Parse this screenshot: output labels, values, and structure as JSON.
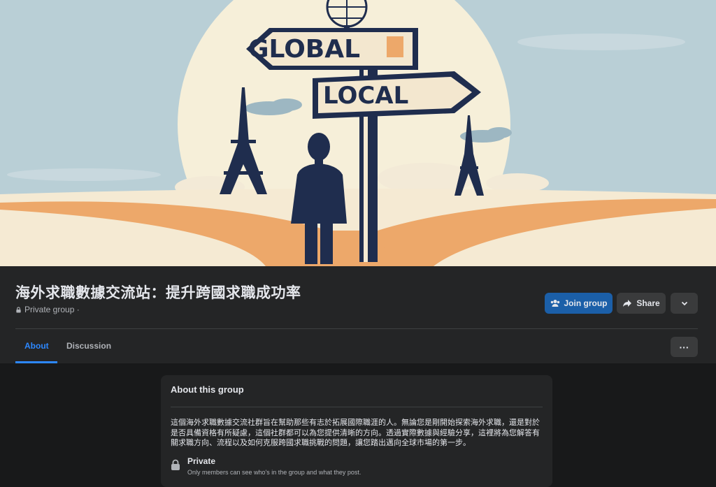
{
  "cover": {
    "sign_global": "GLOBAL",
    "sign_local": "LOCAL",
    "colors": {
      "sky": "#b9cfd6",
      "sun": "#f6efd9",
      "ground": "#f5ead3",
      "road": "#eda86a",
      "navy": "#1f2d4e"
    }
  },
  "group": {
    "title": "海外求職數據交流站：提升跨國求職成功率",
    "privacy": "Private group ·",
    "lock_icon": "lock-icon"
  },
  "actions": {
    "join_label": "Join group",
    "join_icon": "people-icon",
    "share_label": "Share",
    "share_icon": "share-arrow-icon",
    "more_icon": "chevron-down-icon"
  },
  "tabs": [
    {
      "label": "About",
      "active": true
    },
    {
      "label": "Discussion",
      "active": false
    }
  ],
  "tab_more_label": "···",
  "about": {
    "title": "About this group",
    "description": "這個海外求職數據交流社群旨在幫助那些有志於拓展國際職涯的人。無論您是剛開始探索海外求職，還是對於是否具備資格有所疑慮，這個社群都可以為您提供清晰的方向。透過實際數據與經驗分享，這裡將為您解答有關求職方向、流程以及如何克服跨國求職挑戰的問題，讓您踏出邁向全球市場的第一步。",
    "private_label": "Private",
    "private_sub": "Only members can see who's in the group and what they post."
  },
  "colors": {
    "accent": "#2d88ff",
    "join_bg": "#1b5fa8",
    "surface": "#242526",
    "background": "#18191a"
  }
}
